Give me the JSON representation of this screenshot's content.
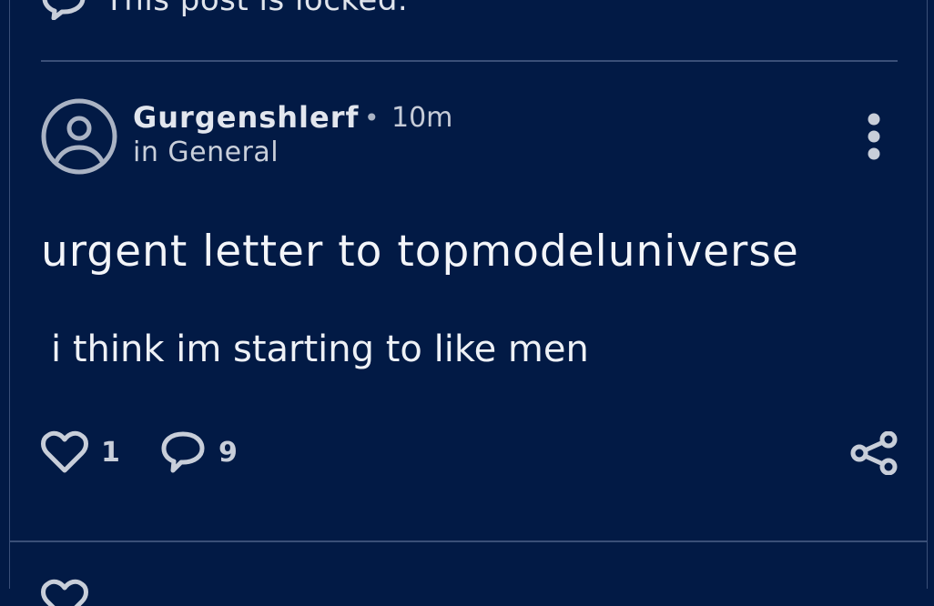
{
  "previous_post": {
    "locked_text": "This post is locked."
  },
  "post": {
    "author": "Gurgenshlerf",
    "separator": "•",
    "time_ago": "10m",
    "category": "in General",
    "title": "urgent letter to topmodeluniverse",
    "body": "i think im starting to like men",
    "likes": "1",
    "comments": "9"
  },
  "icons": {
    "locked": "comment-icon",
    "avatar": "user-circle-icon",
    "more": "more-vertical-icon",
    "like": "heart-icon",
    "comment": "comment-icon",
    "share": "share-icon"
  },
  "colors": {
    "background": "#021a45",
    "divider": "#3a4f78",
    "text_primary": "#f3f5f9",
    "text_secondary": "#c6ccd8",
    "icon": "#c8ced9"
  }
}
